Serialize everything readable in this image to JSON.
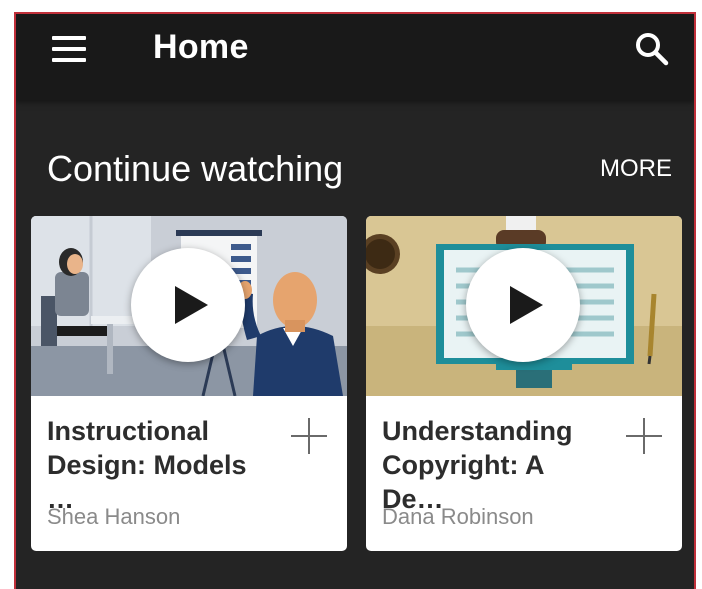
{
  "header": {
    "title": "Home",
    "menu_icon": "hamburger-menu-icon",
    "search_icon": "search-icon",
    "background": "#191919"
  },
  "section": {
    "title": "Continue watching",
    "more_label": "MORE"
  },
  "courses": [
    {
      "title_line1": "Instructional",
      "title_line2": "Design: Models …",
      "author": "Shea Hanson",
      "thumbnail": "presenter-with-whiteboard-illustration"
    },
    {
      "title_line1": "Understanding",
      "title_line2": "Copyright: A De…",
      "author": "Dana Robinson",
      "thumbnail": "open-book-on-desk-illustration"
    }
  ],
  "colors": {
    "background": "#242424",
    "card": "#ffffff",
    "title_text": "#2d2d2d",
    "author_text": "#8a8a8a",
    "frame_border": "#c0303a"
  }
}
